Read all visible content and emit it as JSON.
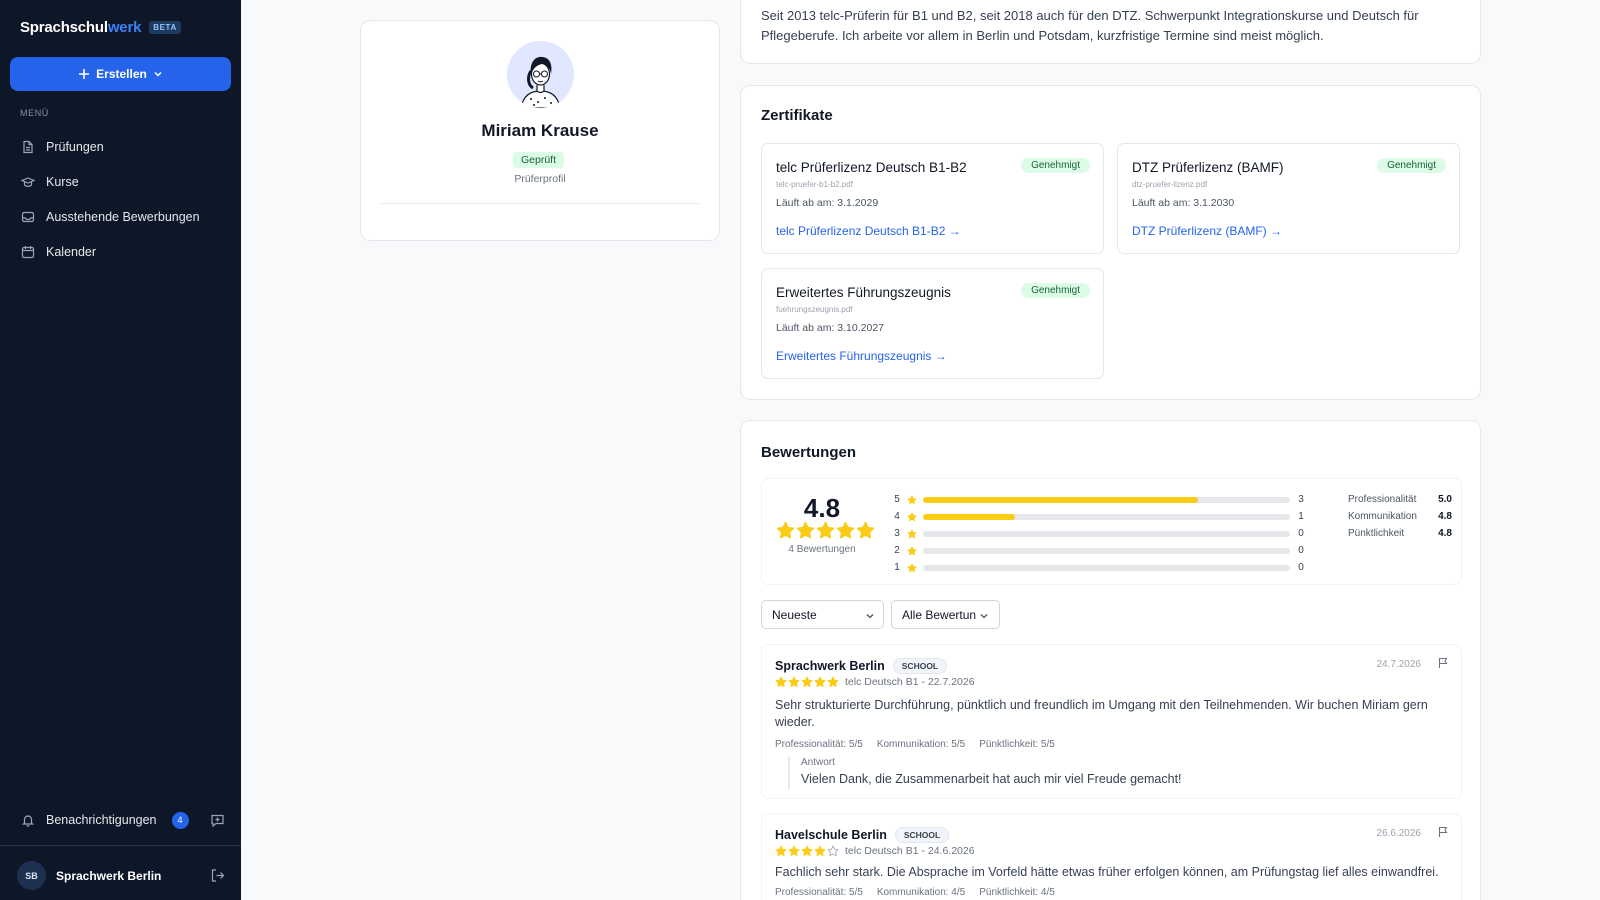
{
  "brand": {
    "name_part1": "Sprachschul",
    "name_part2": "werk",
    "badge": "BETA"
  },
  "sidebar": {
    "create_label": "Erstellen",
    "menu_label": "MENÜ",
    "items": [
      {
        "label": "Prüfungen",
        "icon": "document-icon"
      },
      {
        "label": "Kurse",
        "icon": "graduation-cap-icon"
      },
      {
        "label": "Ausstehende Bewerbungen",
        "icon": "inbox-icon"
      },
      {
        "label": "Kalender",
        "icon": "calendar-icon"
      }
    ],
    "notifications": {
      "label": "Benachrichtigungen",
      "count": "4"
    },
    "user": {
      "initials": "SB",
      "name": "Sprachwerk Berlin"
    }
  },
  "profile": {
    "name": "Miriam Krause",
    "status": "Geprüft",
    "subtitle": "Prüferprofil"
  },
  "about": {
    "text": "Seit 2013 telc-Prüferin für B1 und B2, seit 2018 auch für den DTZ. Schwerpunkt Integrationskurse und Deutsch für Pflegeberufe. Ich arbeite vor allem in Berlin und Potsdam, kurzfristige Termine sind meist möglich."
  },
  "certificates": {
    "title": "Zertifikate",
    "items": [
      {
        "title": "telc Prüferlizenz Deutsch B1-B2",
        "file": "telc-pruefer-b1-b2.pdf",
        "expires": "Läuft ab am: 3.1.2029",
        "link": "telc Prüferlizenz Deutsch B1-B2 →",
        "status": "Genehmigt"
      },
      {
        "title": "DTZ Prüferlizenz (BAMF)",
        "file": "dtz-pruefer-lizenz.pdf",
        "expires": "Läuft ab am: 3.1.2030",
        "link": "DTZ Prüferlizenz (BAMF) →",
        "status": "Genehmigt"
      },
      {
        "title": "Erweitertes Führungszeugnis",
        "file": "fuehrungszeugnis.pdf",
        "expires": "Läuft ab am: 3.10.2027",
        "link": "Erweitertes Führungszeugnis →",
        "status": "Genehmigt"
      }
    ]
  },
  "reviews": {
    "title": "Bewertungen",
    "average": "4.8",
    "average_stars": 5,
    "count_label": "4 Bewertungen",
    "distribution": [
      {
        "stars": "5",
        "count": "3",
        "fraction": 0.75
      },
      {
        "stars": "4",
        "count": "1",
        "fraction": 0.25
      },
      {
        "stars": "3",
        "count": "0",
        "fraction": 0
      },
      {
        "stars": "2",
        "count": "0",
        "fraction": 0
      },
      {
        "stars": "1",
        "count": "0",
        "fraction": 0
      }
    ],
    "criteria": [
      {
        "label": "Professionalität",
        "value": "5.0"
      },
      {
        "label": "Kommunikation",
        "value": "4.8"
      },
      {
        "label": "Pünktlichkeit",
        "value": "4.8"
      }
    ],
    "sort_select": "Neueste",
    "filter_select": "Alle Bewertun",
    "items": [
      {
        "author": "Sprachwerk Berlin",
        "tag": "SCHOOL",
        "date": "24.7.2026",
        "stars": 5,
        "exam": "telc Deutsch B1 - 22.7.2026",
        "text": "Sehr strukturierte Durchführung, pünktlich und freundlich im Umgang mit den Teilnehmenden. Wir buchen Miriam gern wieder.",
        "criteria": [
          "Professionalität: 5/5",
          "Kommunikation: 5/5",
          "Pünktlichkeit: 5/5"
        ],
        "reply_label": "Antwort",
        "reply_text": "Vielen Dank, die Zusammenarbeit hat auch mir viel Freude gemacht!"
      },
      {
        "author": "Havelschule Berlin",
        "tag": "SCHOOL",
        "date": "26.6.2026",
        "stars": 4,
        "exam": "telc Deutsch B1 - 24.6.2026",
        "text": "Fachlich sehr stark. Die Absprache im Vorfeld hätte etwas früher erfolgen können, am Prüfungstag lief alles einwandfrei.",
        "criteria": [
          "Professionalität: 5/5",
          "Kommunikation: 4/5",
          "Pünktlichkeit: 4/5"
        ]
      }
    ]
  },
  "colors": {
    "accent": "#2563eb",
    "sidebar_bg": "#0e1728",
    "star": "#facc15",
    "approved_bg": "#dcfce7",
    "approved_text": "#166534"
  }
}
